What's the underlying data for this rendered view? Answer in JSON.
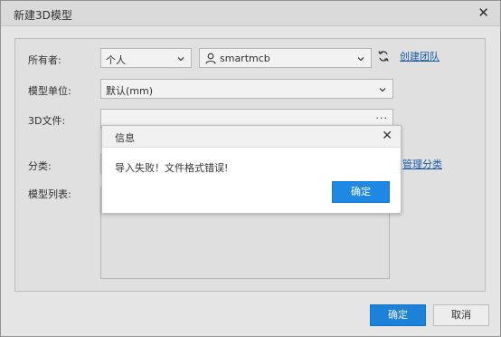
{
  "window": {
    "title": "新建3D模型"
  },
  "owner": {
    "label": "所有者:",
    "type_value": "个人",
    "user_value": "smartmcb",
    "create_team_link": "创建团队"
  },
  "unit": {
    "label": "模型单位:",
    "value": "默认(mm)"
  },
  "file": {
    "label": "3D文件:",
    "browse": "···"
  },
  "category": {
    "label": "分类:",
    "manage_link": "管理分类"
  },
  "model_list": {
    "label": "模型列表:"
  },
  "footer": {
    "ok_label": "确定",
    "cancel_label": "取消"
  },
  "message": {
    "title": "信息",
    "text": "导入失败！文件格式错误!",
    "ok_label": "确定"
  },
  "colors": {
    "accent": "#1e88e5",
    "link": "#1a5fb4"
  }
}
